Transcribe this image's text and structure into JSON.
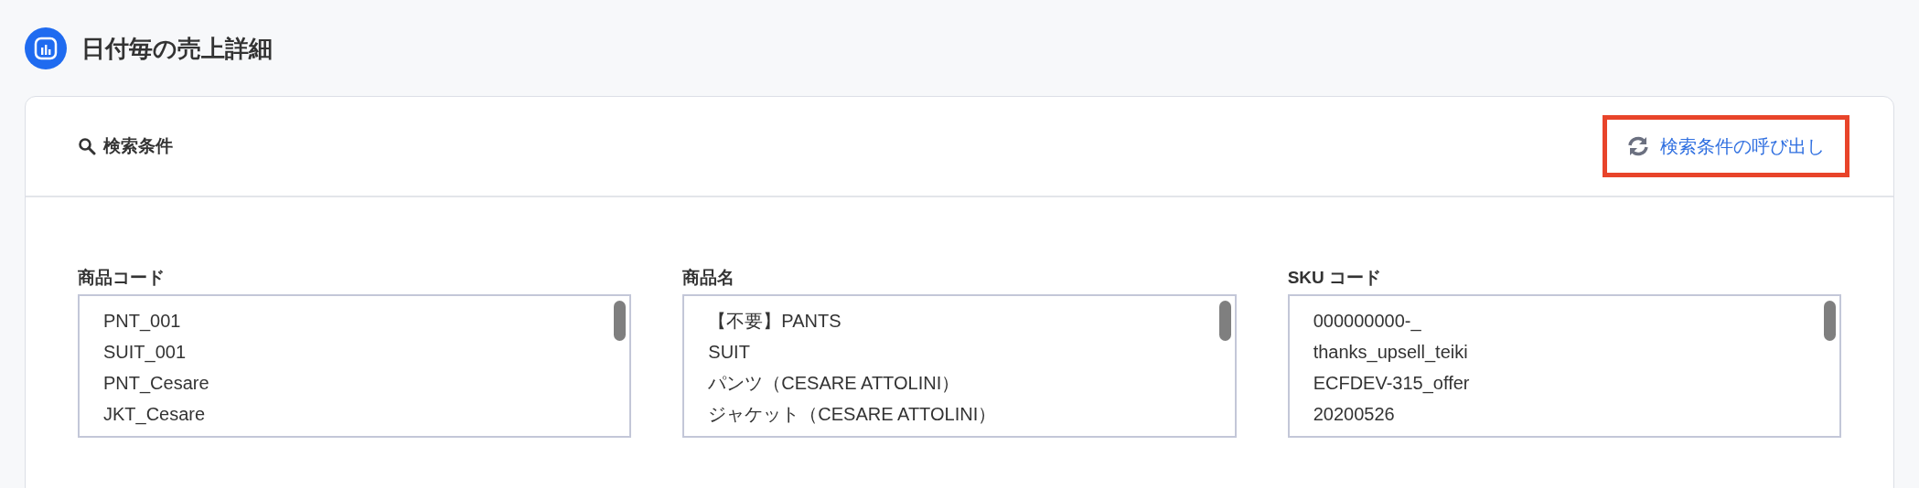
{
  "page_title": "日付毎の売上詳細",
  "search_panel": {
    "title": "検索条件",
    "recall_button": "検索条件の呼び出し",
    "fields": [
      {
        "label": "商品コード",
        "options": [
          "PNT_001",
          "SUIT_001",
          "PNT_Cesare",
          "JKT_Cesare"
        ]
      },
      {
        "label": "商品名",
        "options": [
          "【不要】PANTS",
          "SUIT",
          "パンツ（CESARE ATTOLINI）",
          "ジャケット（CESARE ATTOLINI）"
        ]
      },
      {
        "label": "SKU コード",
        "options": [
          "000000000-_",
          "thanks_upsell_teiki",
          "ECFDEV-315_offer",
          "20200526"
        ]
      }
    ]
  }
}
